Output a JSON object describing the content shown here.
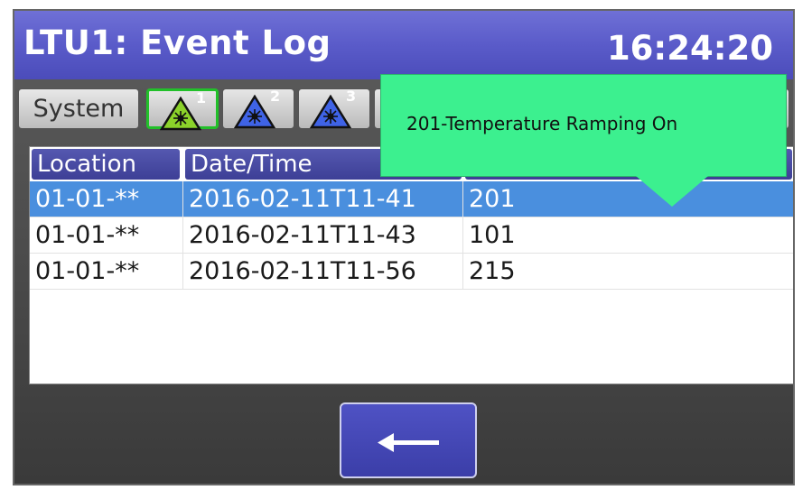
{
  "header": {
    "title": "LTU1: Event Log",
    "clock": "16:24:20"
  },
  "tabs": {
    "system_label": "System",
    "laser_tabs": [
      {
        "number": "1",
        "active": true,
        "icon": "laser-warning-icon"
      },
      {
        "number": "2",
        "active": false,
        "icon": "laser-warning-icon"
      },
      {
        "number": "3",
        "active": false,
        "icon": "laser-warning-icon"
      }
    ]
  },
  "table": {
    "columns": [
      "Location",
      "Date/Time",
      ""
    ],
    "rows": [
      {
        "location": "01-01-**",
        "datetime": "2016-02-11T11-41",
        "event": "201",
        "selected": true
      },
      {
        "location": "01-01-**",
        "datetime": "2016-02-11T11-43",
        "event": "101",
        "selected": false
      },
      {
        "location": "01-01-**",
        "datetime": "2016-02-11T11-56",
        "event": "215",
        "selected": false
      }
    ]
  },
  "tooltip": {
    "text": "201-Temperature Ramping On"
  },
  "footer": {
    "back_icon": "arrow-left-icon"
  },
  "colors": {
    "header": "#5a5bc9",
    "selected_row": "#4a8fde",
    "tooltip": "#3cf08f",
    "active_tab_border": "#22c02a"
  }
}
